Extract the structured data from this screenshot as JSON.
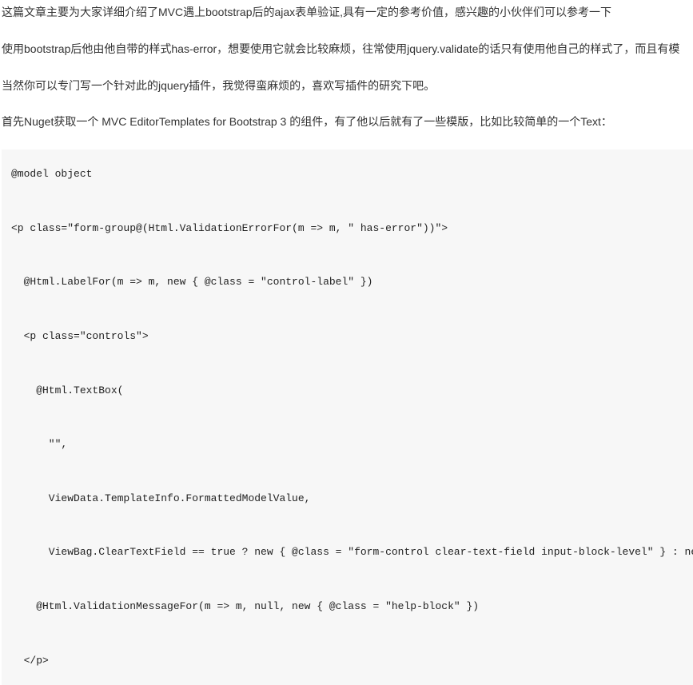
{
  "paragraphs": {
    "p1": "这篇文章主要为大家详细介绍了MVC遇上bootstrap后的ajax表单验证,具有一定的参考价值，感兴趣的小伙伴们可以参考一下",
    "p2": "使用bootstrap后他由他自带的样式has-error，想要使用它就会比较麻烦，往常使用jquery.validate的话只有使用他自己的样式了，而且有模",
    "p3": "当然你可以专门写一个针对此的jquery插件，我觉得蛮麻烦的，喜欢写插件的研究下吧。",
    "p4": "首先Nuget获取一个 MVC EditorTemplates for Bootstrap 3 的组件，有了他以后就有了一些模版，比如比较简单的一个Text："
  },
  "code": {
    "l01": "@model object",
    "l02": "<p class=\"form-group@(Html.ValidationErrorFor(m => m, \" has-error\"))\">",
    "l03": "  @Html.LabelFor(m => m, new { @class = \"control-label\" })",
    "l04": "  <p class=\"controls\">",
    "l05": "    @Html.TextBox(",
    "l06": "      \"\",",
    "l07": "      ViewData.TemplateInfo.FormattedModelValue,",
    "l08": "      ViewBag.ClearTextField == true ? new { @class = \"form-control clear-text-field input-block-level\" } : new { @class = ",
    "l09": "    @Html.ValidationMessageFor(m => m, null, new { @class = \"help-block\" })",
    "l10": "  </p>"
  }
}
